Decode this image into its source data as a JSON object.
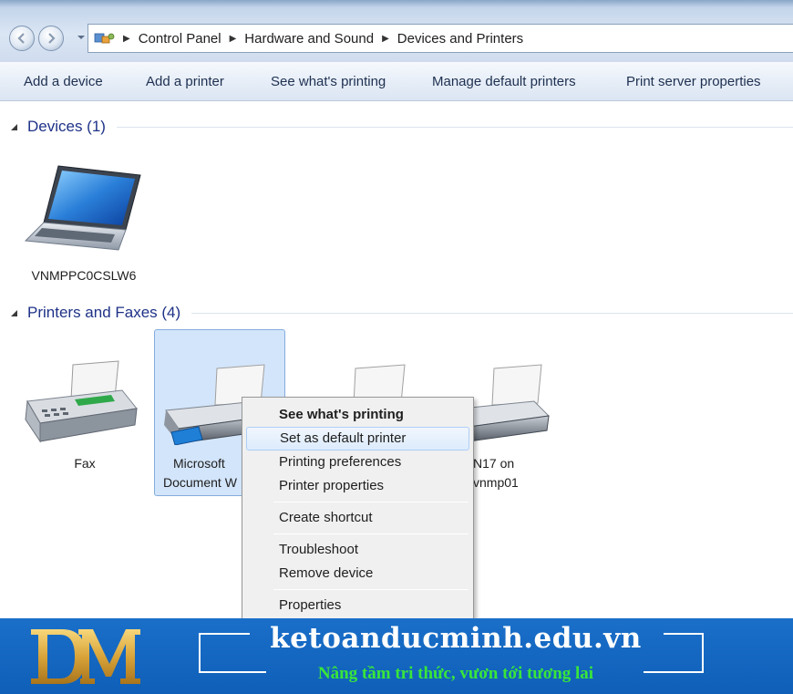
{
  "address_bar": {
    "breadcrumbs": [
      "Control Panel",
      "Hardware and Sound",
      "Devices and Printers"
    ]
  },
  "command_bar": {
    "items": [
      "Add a device",
      "Add a printer",
      "See what's printing",
      "Manage default printers",
      "Print server properties"
    ]
  },
  "devices_group": {
    "title": "Devices (1)",
    "items": [
      {
        "label": "VNMPPC0CSLW6",
        "icon": "laptop-icon"
      }
    ]
  },
  "printers_group": {
    "title": "Printers and Faxes (4)",
    "items": [
      {
        "label_line1": "Fax",
        "icon": "fax-icon"
      },
      {
        "label_line1": "Microsoft",
        "label_line2": "Document W",
        "icon": "printer-icon",
        "selected": true
      },
      {
        "icon": "printer-icon"
      },
      {
        "label_line1": "N17 on",
        "label_line2": "vnmp01",
        "icon": "printer-icon"
      }
    ]
  },
  "context_menu": {
    "items": [
      {
        "label": "See what's printing",
        "bold": true
      },
      {
        "label": "Set as default printer",
        "hover": true
      },
      {
        "label": "Printing preferences"
      },
      {
        "label": "Printer properties"
      },
      {
        "label": "Create shortcut"
      },
      {
        "label": "Troubleshoot"
      },
      {
        "label": "Remove device"
      },
      {
        "label": "Properties"
      }
    ]
  },
  "banner": {
    "site": "ketoanducminh.edu.vn",
    "tagline": "Nâng tầm tri thức, vươn tới tương lai",
    "logo": "ducminh-dm-logo",
    "background_color": "#1367c2",
    "tagline_color": "#39e63a"
  }
}
